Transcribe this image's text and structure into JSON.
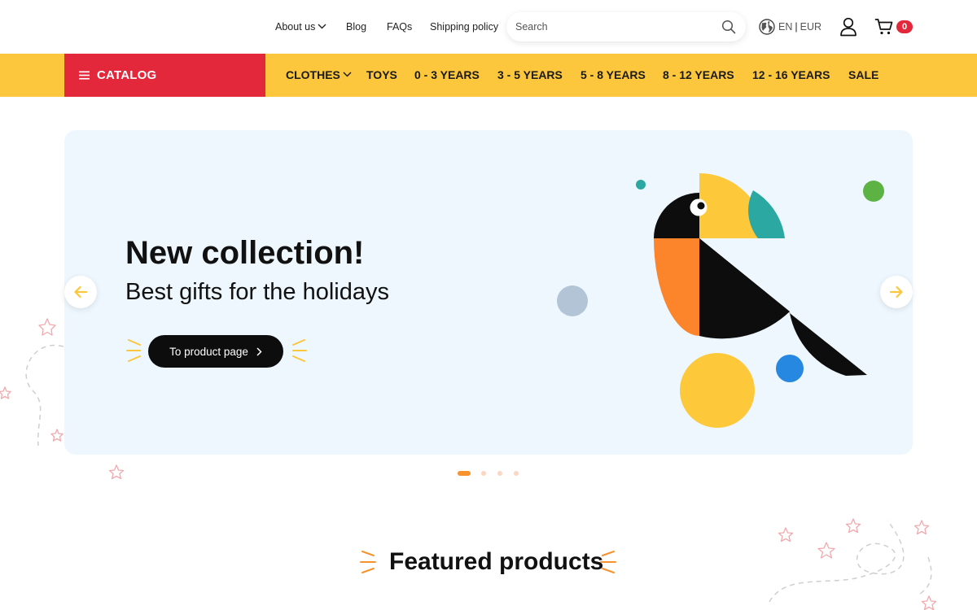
{
  "header": {
    "links": [
      {
        "label": "About us",
        "has_dropdown": true
      },
      {
        "label": "Blog"
      },
      {
        "label": "FAQs"
      },
      {
        "label": "Shipping policy"
      }
    ],
    "search": {
      "placeholder": "Search",
      "value": ""
    },
    "locale": {
      "language": "EN",
      "separator": "|",
      "currency": "EUR"
    },
    "cart": {
      "count": "0"
    },
    "icons": {
      "search": "search-icon",
      "locale": "globe-icon",
      "account": "user-icon",
      "cart": "cart-icon"
    }
  },
  "nav": {
    "catalog_label": "CATALOG",
    "items": [
      {
        "label": "CLOTHES",
        "has_dropdown": true
      },
      {
        "label": "TOYS"
      },
      {
        "label": "0 - 3 YEARS"
      },
      {
        "label": "3 - 5 YEARS"
      },
      {
        "label": "5 - 8 YEARS"
      },
      {
        "label": "8 - 12 YEARS"
      },
      {
        "label": "12 - 16 YEARS"
      },
      {
        "label": "SALE"
      }
    ]
  },
  "hero": {
    "title": "New collection!",
    "subtitle": "Best gifts for the holidays",
    "cta_label": "To product page",
    "slides_total": 4,
    "active_slide": 1
  },
  "featured": {
    "title": "Featured products"
  },
  "colors": {
    "brand_yellow": "#fcc63d",
    "brand_red": "#e3283c",
    "accent_orange": "#f7922d",
    "hero_bg": "#eef7fe",
    "toucan_yellow": "#fdc93a",
    "toucan_teal": "#2ba8a2",
    "toucan_orange": "#fc852c",
    "dot_green": "#5cb343",
    "dot_blue": "#2688e1",
    "dot_gray": "#b3c4d6"
  }
}
